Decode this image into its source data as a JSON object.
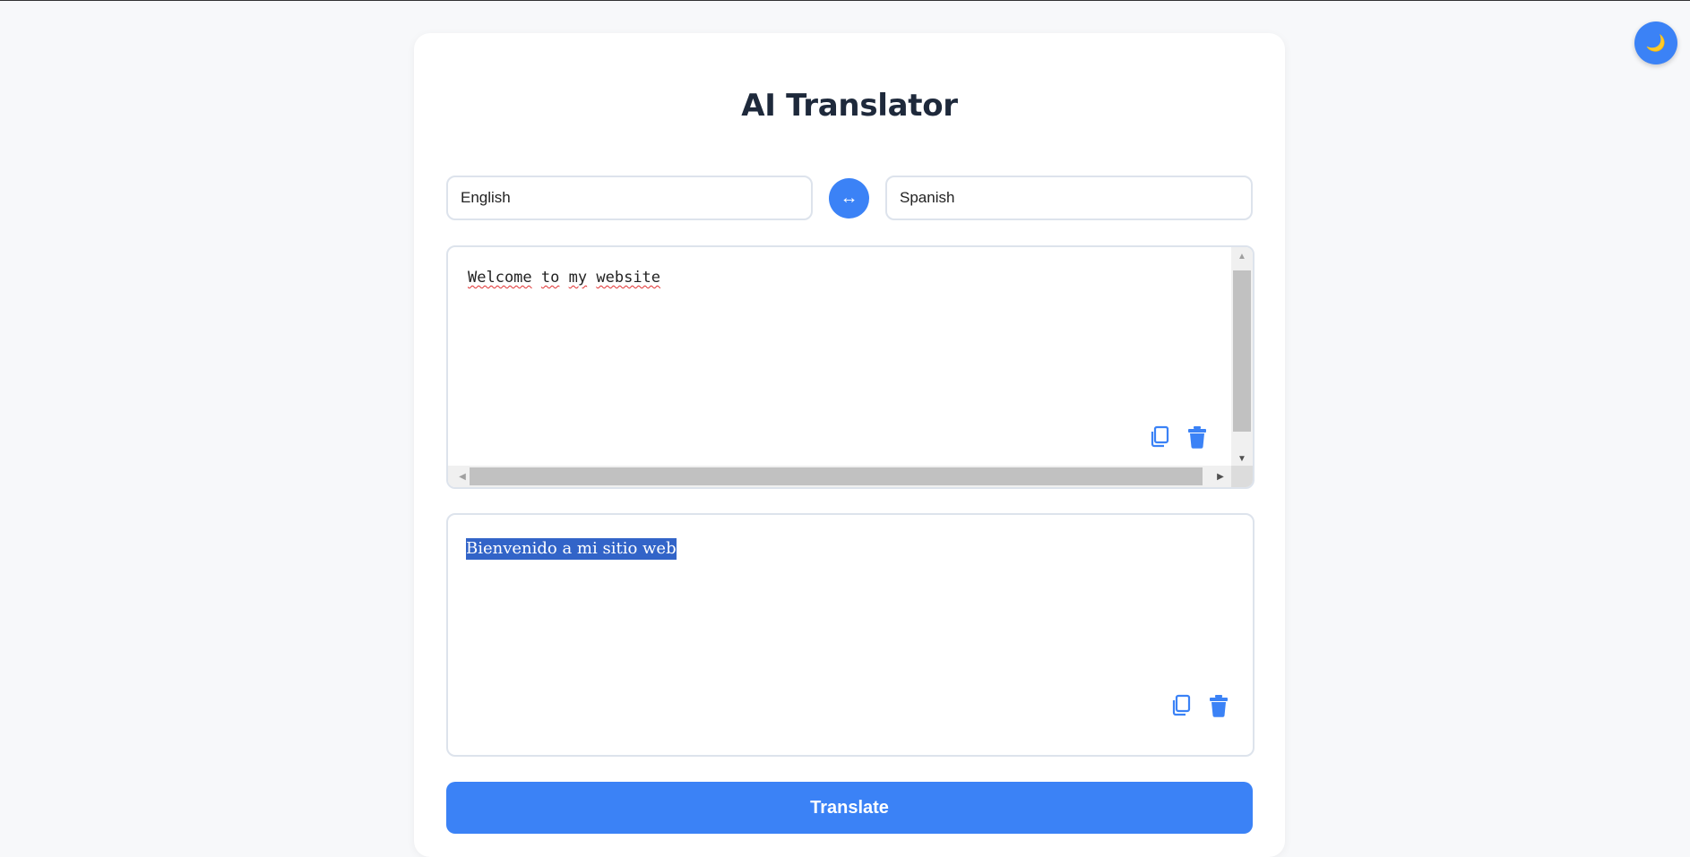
{
  "app": {
    "title": "AI Translator",
    "theme_toggle_icon": "moon-icon",
    "theme_toggle_glyph": "🌙"
  },
  "languages": {
    "source": "English",
    "target": "Spanish",
    "swap_glyph": "↔"
  },
  "input": {
    "words": [
      "Welcome",
      "to",
      "my",
      "website"
    ],
    "copy_icon": "copy-icon",
    "clear_icon": "trash-icon"
  },
  "output": {
    "text": "Bienvenido a mi sitio web",
    "copy_icon": "copy-icon",
    "clear_icon": "trash-icon"
  },
  "actions": {
    "translate_label": "Translate"
  },
  "colors": {
    "accent": "#3b82f6",
    "title": "#1e293b",
    "selection": "#3264c8"
  }
}
